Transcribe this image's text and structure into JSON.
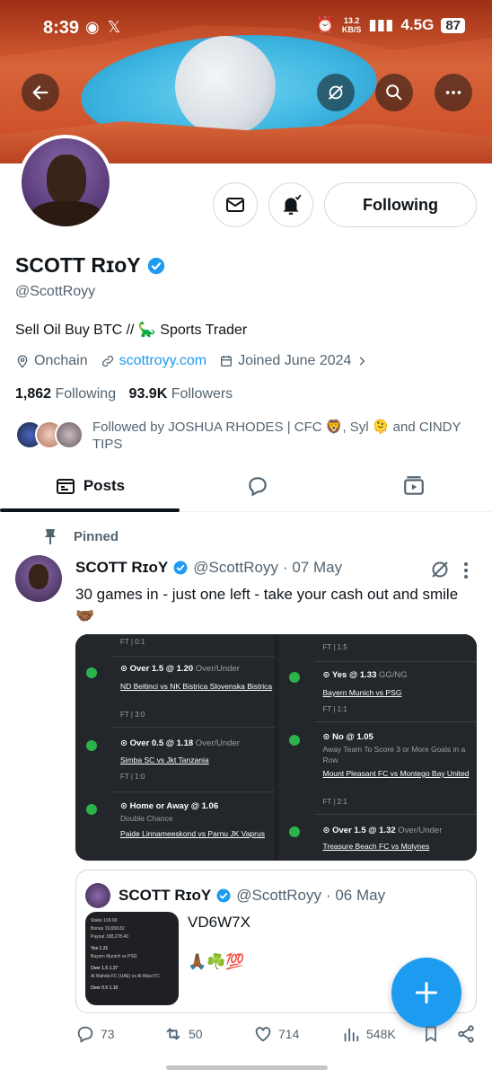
{
  "status_bar": {
    "time": "8:39",
    "kb_top": "13.2",
    "kb_bottom": "KB/S",
    "network": "4.5G",
    "battery": "87"
  },
  "header": {
    "back_icon": "back-arrow-icon",
    "grok_icon": "grok-icon",
    "search_icon": "search-icon",
    "more_icon": "more-icon"
  },
  "profile": {
    "name": "SCOTT RɪoY",
    "handle": "@ScottRoyy",
    "bio": "Sell Oil Buy BTC // 🦕 Sports Trader",
    "location": "Onchain",
    "website": "scottroyy.com",
    "joined": "Joined June 2024",
    "following_count": "1,862",
    "following_label": "Following",
    "followers_count": "93.9K",
    "followers_label": "Followers",
    "followed_by": "Followed by JOSHUA RHODES | CFC 🦁, Syl 🫠 and CINDY TIPS",
    "following_button": "Following"
  },
  "tabs": {
    "posts": "Posts"
  },
  "post": {
    "pinned_label": "Pinned",
    "author": "SCOTT RɪoY",
    "handle": "@ScottRoyy",
    "date": "· 07 May",
    "text": "30 games in - just one left - take your cash out and smile 🤝🏾",
    "bets_left": [
      {
        "ft_top": "FT | 0:1"
      },
      {
        "title": "Over 1.5 @ 1.20",
        "market": "Over/Under",
        "match": "ND Beltinci vs NK Bistrica Slovenska Bistrica",
        "ft": "FT | 3:0"
      },
      {
        "title": "Over 0.5 @ 1.18",
        "market": "Over/Under",
        "match": "Simba SC vs Jkt Tanzania",
        "ft": "FT | 1:0"
      },
      {
        "title": "Home or Away @ 1.06",
        "market": "Double Chance",
        "match": "Paide Linnameeskond vs Parnu JK Vaprus"
      }
    ],
    "bets_right": [
      {
        "ft_top": "FT | 1:5"
      },
      {
        "title": "Yes @ 1.33",
        "market": "GG/NG",
        "match": "Bayern Munich vs PSG",
        "ft": "FT | 1:1"
      },
      {
        "title": "No @ 1.05",
        "market": "Away Team To Score 3 or More Goals in a Row",
        "match": "Mount Pleasant FC vs Montego Bay United",
        "ft": "FT | 2:1"
      },
      {
        "title": "Over 1.5 @ 1.32",
        "market": "Over/Under",
        "match": "Treasure Beach FC vs Molynes"
      }
    ],
    "quote": {
      "author": "SCOTT RɪoY",
      "handle": "@ScottRoyy",
      "date": "· 06 May",
      "text": "VD6W7X",
      "emoji": "🙏🏾☘️💯",
      "thumb_lines": [
        "Stake 100.00",
        "Bonus 19,658.82",
        "Payout 188,278.40",
        "Yes 1.31",
        "Bayern Munich vs PSG",
        "Over 1.5 1.37",
        "Al Wahda FC (UAE) vs Al Wasl FC",
        "Over 0.5 1.10"
      ]
    },
    "replies": "73",
    "reposts": "50",
    "likes": "714",
    "views": "548K"
  },
  "colors": {
    "accent": "#1d9bf0",
    "verified": "#1d9bf0",
    "text": "#0f1419",
    "muted": "#536471"
  }
}
